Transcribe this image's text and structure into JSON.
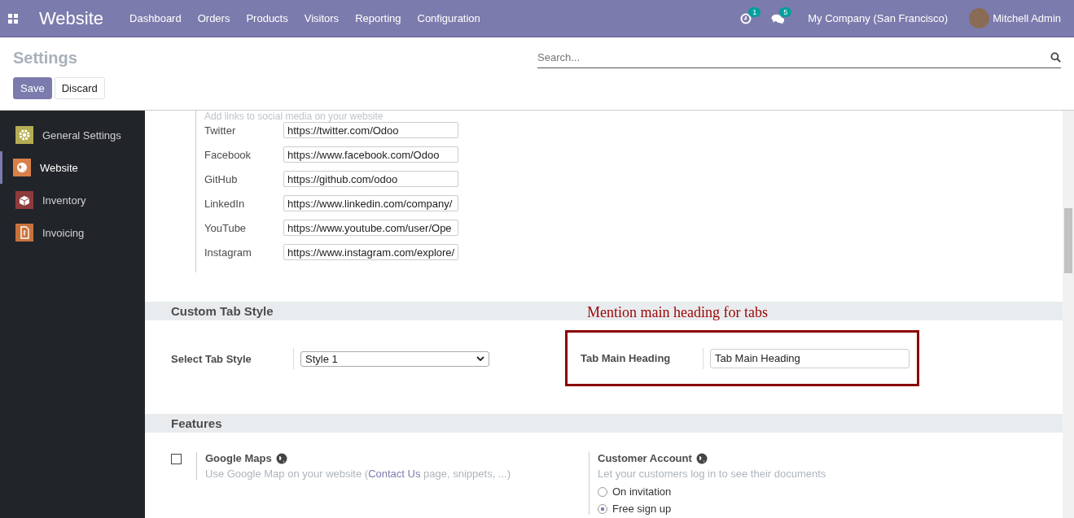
{
  "navbar": {
    "app_title": "Website",
    "menu": [
      "Dashboard",
      "Orders",
      "Products",
      "Visitors",
      "Reporting",
      "Configuration"
    ],
    "activity_count": "1",
    "message_count": "5",
    "company": "My Company (San Francisco)",
    "user": "Mitchell Admin"
  },
  "control_panel": {
    "title": "Settings",
    "search": {
      "placeholder": "Search..."
    },
    "buttons": [
      {
        "label": "Save",
        "kind": "primary"
      },
      {
        "label": "Discard",
        "kind": "secondary"
      }
    ]
  },
  "sidebar": {
    "items": [
      {
        "label": "General Settings",
        "selected": false
      },
      {
        "label": "Website",
        "selected": true
      },
      {
        "label": "Inventory",
        "selected": false
      },
      {
        "label": "Invoicing",
        "selected": false
      }
    ]
  },
  "social": {
    "description": "Add links to social media on your website",
    "links": [
      {
        "label": "Twitter",
        "value": "https://twitter.com/Odoo"
      },
      {
        "label": "Facebook",
        "value": "https://www.facebook.com/Odoo"
      },
      {
        "label": "GitHub",
        "value": "https://github.com/odoo"
      },
      {
        "label": "LinkedIn",
        "value": "https://www.linkedin.com/company/"
      },
      {
        "label": "YouTube",
        "value": "https://www.youtube.com/user/Ope"
      },
      {
        "label": "Instagram",
        "value": "https://www.instagram.com/explore/"
      }
    ]
  },
  "custom_tab_style": {
    "heading": "Custom Tab Style",
    "annotation": "Mention main heading for tabs",
    "select_label": "Select Tab Style",
    "select_value": "Style 1",
    "main_heading_label": "Tab Main Heading",
    "main_heading_value": "Tab Main Heading"
  },
  "features": {
    "heading": "Features",
    "google_maps": {
      "title": "Google Maps",
      "checked": false,
      "description_before": "Use Google Map on your website (",
      "link": "Contact Us",
      "description_after": " page, snippets, ...)"
    },
    "customer_account": {
      "title": "Customer Account",
      "description": "Let your customers log in to see their documents",
      "options": [
        {
          "label": "On invitation",
          "selected": false
        },
        {
          "label": "Free sign up",
          "selected": true
        }
      ]
    }
  }
}
